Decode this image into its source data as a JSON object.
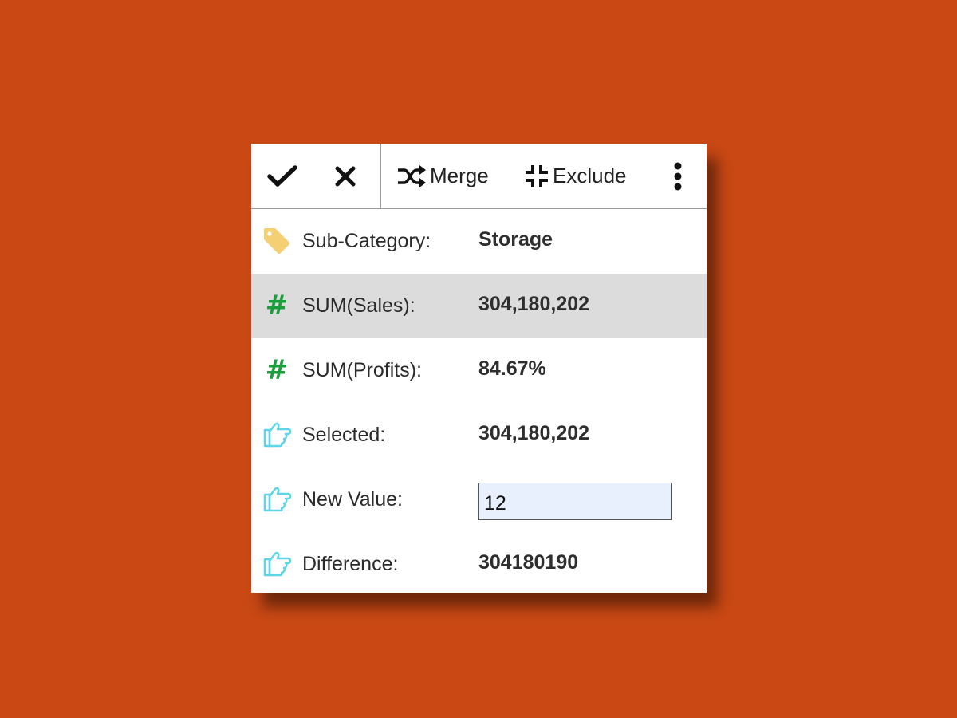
{
  "toolbar": {
    "confirm_icon": "checkmark-icon",
    "cancel_icon": "close-icon",
    "merge_label": "Merge",
    "merge_icon": "shuffle-icon",
    "exclude_label": "Exclude",
    "exclude_icon": "compress-icon",
    "more_icon": "vertical-dots-icon"
  },
  "rows": [
    {
      "icon": "tag-icon",
      "label": "Sub-Category:",
      "value": "Storage",
      "highlighted": false
    },
    {
      "icon": "hash-icon",
      "label": "SUM(Sales):",
      "value": "304,180,202",
      "highlighted": true
    },
    {
      "icon": "hash-icon",
      "label": "SUM(Profits):",
      "value": "84.67%",
      "highlighted": false
    },
    {
      "icon": "pointing-hand-icon",
      "label": "Selected:",
      "value": "304,180,202",
      "highlighted": false
    },
    {
      "icon": "pointing-hand-icon",
      "label": "New Value:",
      "value": "12",
      "highlighted": false
    },
    {
      "icon": "pointing-hand-icon",
      "label": "Difference:",
      "value": "304180190",
      "highlighted": false
    }
  ],
  "colors": {
    "background": "#c94814",
    "hash_icon": "#1a9e3c",
    "tag_icon": "#f5cf73",
    "hand_icon": "#5fd4e6",
    "highlight_row": "#dcdcdc",
    "input_bg": "#e8f0fe"
  }
}
